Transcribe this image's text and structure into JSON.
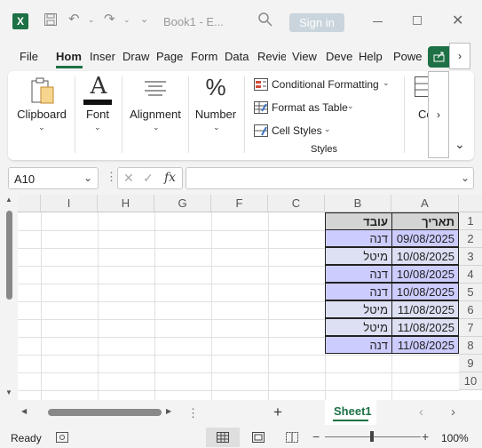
{
  "window": {
    "doc_title": "Book1 - E...",
    "signin_label": "Sign in"
  },
  "tabs": [
    "File",
    "Hom",
    "Inser",
    "Draw",
    "Page",
    "Form",
    "Data",
    "Revie",
    "View",
    "Deve",
    "Help",
    "Powe"
  ],
  "ribbon": {
    "clipboard": "Clipboard",
    "font": "Font",
    "alignment": "Alignment",
    "number": "Number",
    "conditional_formatting": "Conditional Formatting",
    "format_as_table": "Format as Table",
    "cell_styles": "Cell Styles",
    "styles_group": "Styles",
    "cells_partial": "Ce"
  },
  "formula_bar": {
    "name_box": "A10",
    "fx": "fx",
    "value": ""
  },
  "columns": [
    "A",
    "B",
    "C",
    "F",
    "G",
    "H",
    "I"
  ],
  "rows": [
    "1",
    "2",
    "3",
    "4",
    "5",
    "6",
    "7",
    "8",
    "9",
    "10"
  ],
  "table": {
    "headers": [
      "תאריך",
      "עובד"
    ],
    "rows": [
      [
        "09/08/2025",
        "דנה"
      ],
      [
        "10/08/2025",
        "מיטל"
      ],
      [
        "10/08/2025",
        "דנה"
      ],
      [
        "10/08/2025",
        "דנה"
      ],
      [
        "11/08/2025",
        "מיטל"
      ],
      [
        "11/08/2025",
        "מיטל"
      ],
      [
        "11/08/2025",
        "דנה"
      ]
    ],
    "row_colors": [
      "#ccccff",
      "#dde0f3",
      "#ccccff",
      "#ccccff",
      "#dde0f3",
      "#dde0f3",
      "#ccccff"
    ],
    "header_color": "#d4d4d4"
  },
  "sheets": {
    "active": "Sheet1",
    "add_label": "+"
  },
  "status": {
    "ready": "Ready",
    "zoom": "100%",
    "zoom_level": 1.0,
    "minus": "−",
    "plus": "+"
  },
  "icons": {
    "app": "excel-icon",
    "save": "save-icon",
    "undo": "undo-icon",
    "redo": "redo-icon"
  },
  "colors": {
    "accent": "#1e7145",
    "cond_fmt": "#d14c3b"
  }
}
